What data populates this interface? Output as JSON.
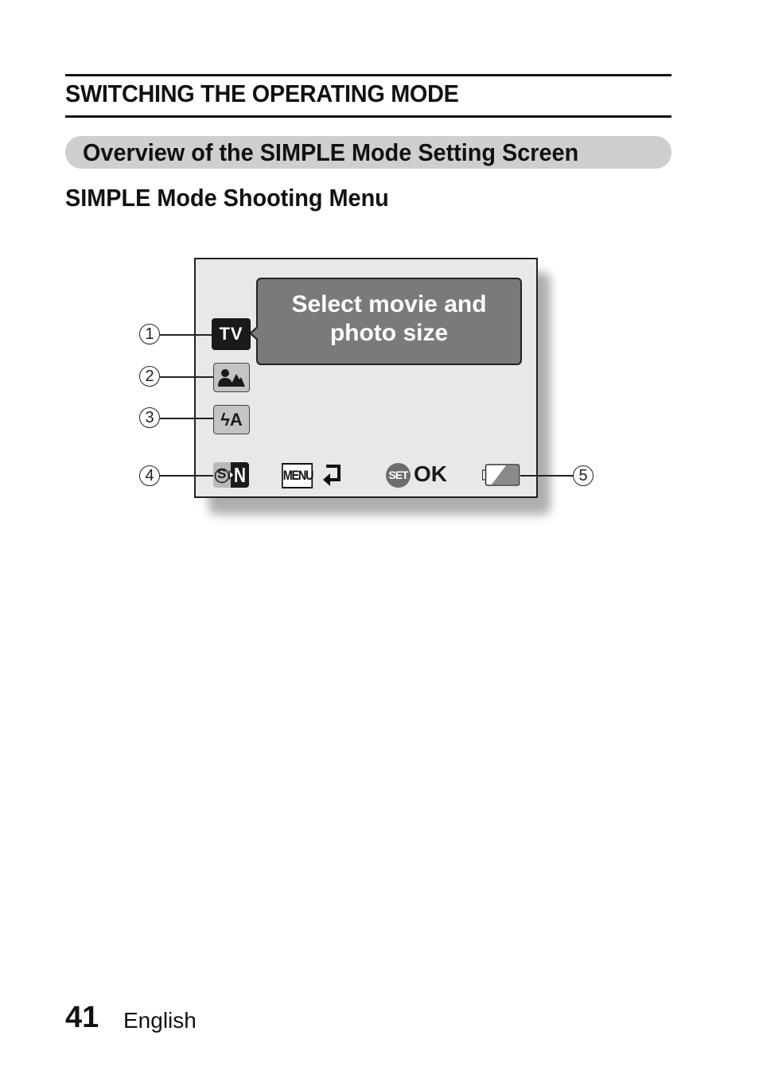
{
  "section_title": "SWITCHING THE OPERATING MODE",
  "subsection_title": "Overview of the SIMPLE Mode Setting Screen",
  "heading": "SIMPLE Mode Shooting Menu",
  "diagram": {
    "bubble_line1": "Select movie and",
    "bubble_line2": "photo size",
    "icons": [
      {
        "id": "tv-icon",
        "label": "TV",
        "callout": "1"
      },
      {
        "id": "scene-icon",
        "label": "",
        "callout": "2"
      },
      {
        "id": "flash-auto-icon",
        "label": "ϟA",
        "callout": "3"
      },
      {
        "id": "sn-mode-icon",
        "label_s": "S",
        "label_n": "N",
        "callout": "4"
      },
      {
        "id": "battery-icon",
        "callout": "5"
      }
    ],
    "menu_label": "MENU",
    "set_label": "SET",
    "ok_label": "OK"
  },
  "footer": {
    "page_number": "41",
    "language": "English"
  }
}
